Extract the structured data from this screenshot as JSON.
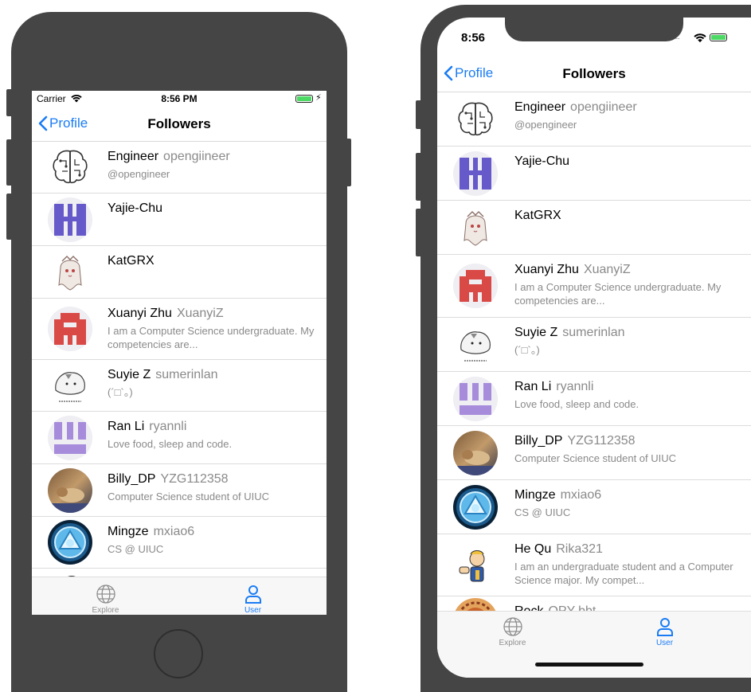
{
  "accent_color": "#1a7cf5",
  "left_device": {
    "status_bar": {
      "carrier": "Carrier",
      "time": "8:56 PM"
    },
    "nav": {
      "back_label": "Profile",
      "title": "Followers"
    },
    "tabs": [
      {
        "label": "Explore",
        "icon": "globe-icon"
      },
      {
        "label": "User",
        "icon": "user-icon"
      }
    ]
  },
  "right_device": {
    "status_bar": {
      "time": "8:56"
    },
    "nav": {
      "back_label": "Profile",
      "title": "Followers"
    },
    "tabs": [
      {
        "label": "Explore",
        "icon": "globe-icon"
      },
      {
        "label": "User",
        "icon": "user-icon"
      }
    ]
  },
  "followers": [
    {
      "name": "Engineer",
      "username": "opengiineer",
      "bio": "@opengineer",
      "avatar": "brain-avatar"
    },
    {
      "name": "Yajie-Chu",
      "username": "",
      "bio": "",
      "avatar": "purple-identicon-avatar"
    },
    {
      "name": "KatGRX",
      "username": "",
      "bio": "",
      "avatar": "anime-girl-avatar"
    },
    {
      "name": "Xuanyi Zhu",
      "username": "XuanyiZ",
      "bio": "I am a Computer Science undergraduate. My competencies are...",
      "avatar": "red-identicon-avatar"
    },
    {
      "name": "Suyie Z",
      "username": "sumerinlan",
      "bio": "(´□`。)",
      "avatar": "hamster-avatar"
    },
    {
      "name": "Ran Li",
      "username": "ryannli",
      "bio": "Love food, sleep and code.",
      "avatar": "lavender-identicon-avatar"
    },
    {
      "name": "Billy_DP",
      "username": "YZG112358",
      "bio": "Computer Science student of UIUC",
      "avatar": "cat-photo-avatar"
    },
    {
      "name": "Mingze",
      "username": "mxiao6",
      "bio": "CS @ UIUC",
      "avatar": "arc-reactor-avatar"
    },
    {
      "name": "He Qu",
      "username": "Rika321",
      "bio": "I am an undergraduate student and a Computer Science major. My compet...",
      "avatar": "vault-boy-avatar"
    },
    {
      "name": "Rock",
      "username": "OPY-bbt",
      "bio": "",
      "avatar": "orange-pattern-avatar"
    }
  ]
}
